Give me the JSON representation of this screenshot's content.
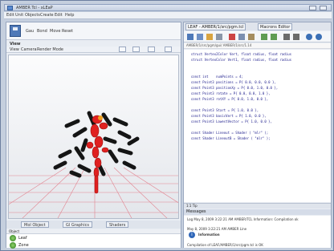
{
  "window": {
    "title": "AMBER Tcl - xLEaP"
  },
  "menubar": [
    "Edit",
    "Unit",
    "Objects",
    "Create",
    "Edit",
    "Help"
  ],
  "toolbar": {
    "labels": [
      "Gau",
      "Bond",
      "Move",
      "Reset"
    ]
  },
  "view": {
    "title": "View",
    "menu": [
      "View",
      "Camera",
      "Render Mode"
    ],
    "buttons": [
      "pointer-icon",
      "add-icon",
      "rotate-icon",
      "zoom-icon"
    ]
  },
  "bottom_tabs": [
    "Mol Object",
    "Gl Graphics",
    "Shaders"
  ],
  "object_list": {
    "header": "Object",
    "items": [
      "Leaf",
      "Zone"
    ]
  },
  "editor": {
    "tabs": [
      "LEAF - AMBER/1/src/pgm.tcl",
      "Macrons Editor"
    ],
    "path": "AMBER/1/src/pgm/gui/ AMBER/1/src/1.14",
    "code_lines": [
      "  struct Vertex2Color Vert, float radius, float radius",
      "  struct VertexColor Vert1, float radius, float radius",
      "",
      "",
      "  const int    numPoints = 4;",
      "  const Point3 positions = P{ 0.0, 0.0, 0.0 },",
      "  const Point3 positionXy = P{ 0.0, 1.0, 0.0 },",
      "  const Point3 rotate = P{ 0.0, 0.0, 1.0 },",
      "  const Point3 rotXY = P{ 0.0, 1.0, 0.0 },",
      "",
      "  const Point3 Start = P{ 1.0, 0.0 },",
      "  const Point3 basicVert = P{ 1.0, 0.0 },",
      "  const Point3 LowestVector = P{ 1.0, 0.0 },",
      "",
      "  const Shader Lineout = Shader ( \"mlr\" );",
      "  const Shader LineoutB = Shader ( \"mlr\" );"
    ],
    "tip": "1:1 Tip"
  },
  "messages": {
    "header": "Messages",
    "lines": [
      "Log May 8, 2009 3:22:21 AM AMBER/TCL Information: Compilation ok",
      "",
      "May 8, 2009 3:22:21 AM AMBER Line",
      "Information",
      "",
      "Compilation of LEAF/AMBER/1/src/pgm.tcl is OK"
    ]
  },
  "colors": {
    "molecule": "#e02020",
    "ligand": "#151515",
    "grid": "#e06a78"
  }
}
